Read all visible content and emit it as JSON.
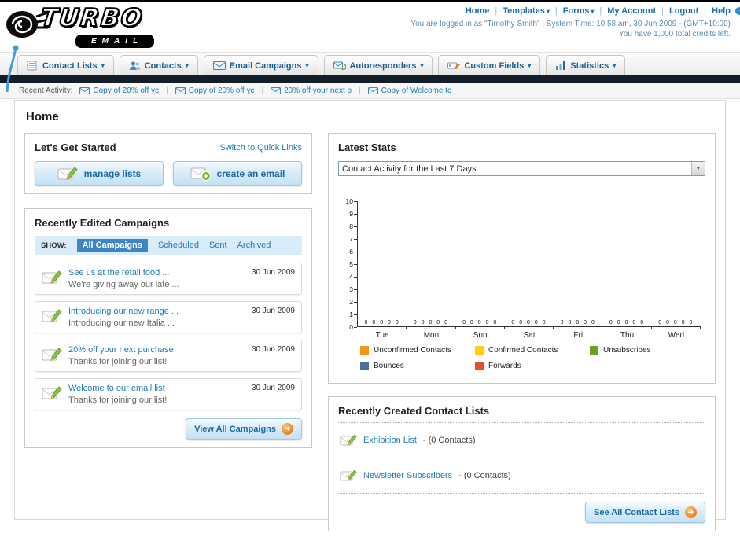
{
  "icons": {
    "chevron_down": "▾",
    "dropdown_arrow": "▼",
    "arrow_right": "➜"
  },
  "header": {
    "logo": {
      "title": "TURBO",
      "subtitle": "EMAIL"
    },
    "links": [
      {
        "label": "Home"
      },
      {
        "label": "Templates"
      },
      {
        "label": "Forms"
      },
      {
        "label": "My Account"
      },
      {
        "label": "Logout"
      },
      {
        "label": "Help"
      }
    ],
    "login_status": "You are logged in as \"Timothy Smith\" | System Time: 10:58 am, 30 Jun 2009 - (GMT+10:00)",
    "credits_note": "You have 1,000 total credits left."
  },
  "nav": {
    "items": [
      {
        "label": "Contact Lists"
      },
      {
        "label": "Contacts"
      },
      {
        "label": "Email Campaigns"
      },
      {
        "label": "Autoresponders"
      },
      {
        "label": "Custom Fields"
      },
      {
        "label": "Statistics"
      }
    ]
  },
  "recent_activity": {
    "label": "Recent Activity:",
    "items": [
      {
        "label": "Copy of 20% off yc"
      },
      {
        "label": "Copy of 20% off yc"
      },
      {
        "label": "20% off your next p"
      },
      {
        "label": "Copy of Welcome tc"
      }
    ]
  },
  "page": {
    "title": "Home"
  },
  "get_started": {
    "title": "Let's Get Started",
    "switch_link": "Switch to Quick Links",
    "manage_lists_label": "manage lists",
    "create_email_label": "create an email"
  },
  "campaigns": {
    "title": "Recently Edited Campaigns",
    "show_label": "SHOW:",
    "tabs": [
      {
        "label": "All Campaigns",
        "selected": true
      },
      {
        "label": "Scheduled",
        "selected": false
      },
      {
        "label": "Sent",
        "selected": false
      },
      {
        "label": "Archived",
        "selected": false
      }
    ],
    "items": [
      {
        "title": "See us at the retail food ...",
        "subtitle": "We're giving away our late ...",
        "date": "30 Jun 2009"
      },
      {
        "title": "Introducing our new range ...",
        "subtitle": "Introducing our new Italia ...",
        "date": "30 Jun 2009"
      },
      {
        "title": "20% off your next purchase",
        "subtitle": "Thanks for joining our list!",
        "date": "30 Jun 2009"
      },
      {
        "title": "Welcome to our email list",
        "subtitle": "Thanks for joining our list!",
        "date": "30 Jun 2009"
      }
    ],
    "view_all_label": "View All Campaigns"
  },
  "stats": {
    "title": "Latest Stats",
    "period_selector": "Contact Activity for the Last 7 Days"
  },
  "chart_data": {
    "type": "bar",
    "title": "Contact Activity for the Last 7 Days",
    "categories": [
      "Tue",
      "Mon",
      "Sun",
      "Sat",
      "Fri",
      "Thu",
      "Wed"
    ],
    "series": [
      {
        "name": "Unconfirmed Contacts",
        "color": "#f7941d",
        "values": [
          0,
          0,
          0,
          0,
          0,
          0,
          0
        ]
      },
      {
        "name": "Confirmed Contacts",
        "color": "#ffd200",
        "values": [
          0,
          0,
          0,
          0,
          0,
          0,
          0
        ]
      },
      {
        "name": "Unsubscribes",
        "color": "#68a225",
        "values": [
          0,
          0,
          0,
          0,
          0,
          0,
          0
        ]
      },
      {
        "name": "Bounces",
        "color": "#4e6e9e",
        "values": [
          0,
          0,
          0,
          0,
          0,
          0,
          0
        ]
      },
      {
        "name": "Forwards",
        "color": "#e8502d",
        "values": [
          0,
          0,
          0,
          0,
          0,
          0,
          0
        ]
      }
    ],
    "ylim": [
      0,
      10
    ],
    "y_tick_step": 1,
    "xlabel": "",
    "ylabel": "",
    "grid": false,
    "legend_position": "bottom"
  },
  "contact_lists": {
    "title": "Recently Created Contact Lists",
    "items": [
      {
        "name": "Exhibition List",
        "detail": "- (0 Contacts)"
      },
      {
        "name": "Newsletter Subscribers",
        "detail": "- (0 Contacts)"
      }
    ],
    "see_all_label": "See All Contact Lists"
  }
}
